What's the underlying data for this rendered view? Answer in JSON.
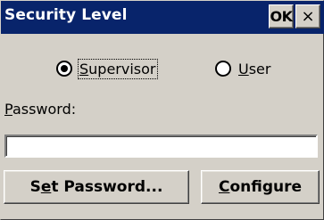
{
  "window": {
    "title": "Security Level",
    "ok_label": "OK",
    "close_glyph": "×"
  },
  "mode": {
    "selected": "supervisor",
    "supervisor": {
      "pre": "",
      "key": "S",
      "post": "upervisor"
    },
    "user": {
      "pre": "",
      "key": "U",
      "post": "ser"
    }
  },
  "password": {
    "label_key": "P",
    "label_rest": "assword:",
    "value": "",
    "placeholder": ""
  },
  "buttons": {
    "set_password": {
      "pre": "S",
      "key": "e",
      "post": "t Password..."
    },
    "configure": {
      "pre": "",
      "key": "C",
      "post": "onfigure"
    }
  },
  "colors": {
    "title_bar": "#08246b",
    "face": "#d4d0c8"
  }
}
